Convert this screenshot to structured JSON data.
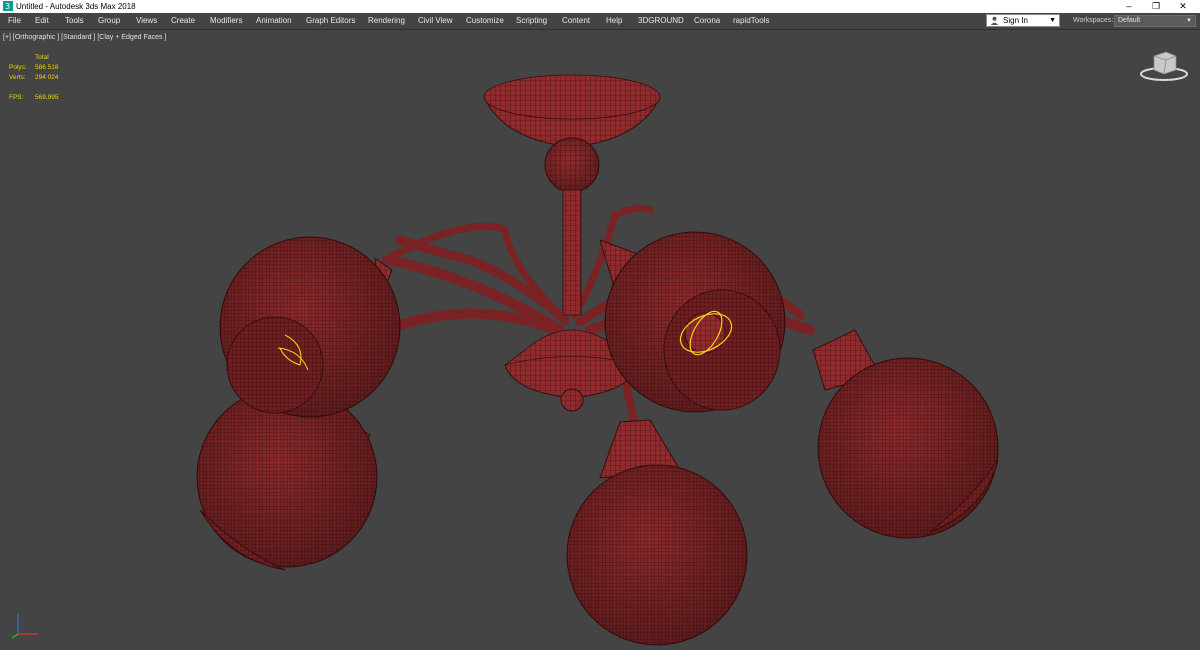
{
  "window": {
    "title": "Untitled - Autodesk 3ds Max 2018",
    "controls": {
      "minimize": "–",
      "restore": "❐",
      "close": "✕"
    }
  },
  "menu": [
    "File",
    "Edit",
    "Tools",
    "Group",
    "Views",
    "Create",
    "Modifiers",
    "Animation",
    "Graph Editors",
    "Rendering",
    "Civil View",
    "Customize",
    "Scripting",
    "Content",
    "Help",
    "3DGROUND",
    "Corona",
    "rapidTools"
  ],
  "signin": {
    "label": "Sign In",
    "icon": "user-icon"
  },
  "workspaces": {
    "label": "Workspaces:",
    "value": "Default"
  },
  "viewport": {
    "label": "[+] [Orthographic ] [Standard ] [Clay + Edged Faces ]",
    "stats": {
      "total_label": "Total",
      "polys_label": "Polys:",
      "polys": "586 518",
      "verts_label": "Verts:",
      "verts": "294 024",
      "fps_label": "FPS:",
      "fps": "569,995"
    }
  },
  "colors": {
    "viewport_bg": "#444444",
    "model_fill": "#8f2b2d",
    "wire": "#3a0c0e",
    "stats_text": "#f0d400",
    "selection_gizmo": "#ffd21a"
  }
}
